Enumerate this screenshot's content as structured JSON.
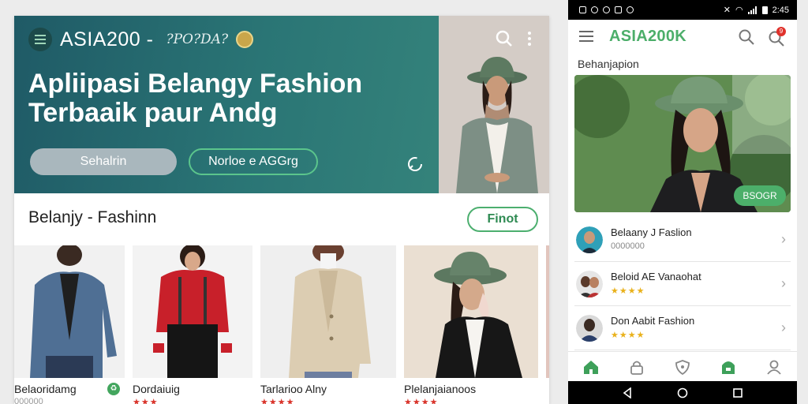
{
  "desktop": {
    "brand": "ASIA200 -",
    "brand_sub": "?PO?DA?",
    "headline_line1": "Apliipasi Belangy Fashion",
    "headline_line2": "Terbaaik paur Andg",
    "primary_button": "Sehalrin",
    "outline_button": "Norloe e AGGrg",
    "section_title": "Belanjy - Fashinn",
    "find_button": "Finot",
    "products": [
      {
        "name": "Belaoridamg",
        "sub": "000000"
      },
      {
        "name": "Dordaiuig",
        "stars": "★★★"
      },
      {
        "name": "Tarlarioo Alny",
        "stars": "★★★★"
      },
      {
        "name": "Plelanjaianoos",
        "stars": "★★★★"
      }
    ]
  },
  "phone": {
    "status_time": "2:45",
    "app_brand": "ASIA200K",
    "notif_count": "9",
    "section": "Behanjapion",
    "hero_button": "BSOGR",
    "list": [
      {
        "title": "Belaany J Faslion",
        "sub": "0000000"
      },
      {
        "title": "Beloid AE Vanaohat",
        "stars": "★★★★"
      },
      {
        "title": "Don Aabit Fashion",
        "stars": "★★★★"
      }
    ]
  },
  "colors": {
    "hero_teal": "#2a7575",
    "brand_green": "#4cae6a",
    "accent_red": "#d9342b",
    "star_gold": "#e9b11b"
  }
}
